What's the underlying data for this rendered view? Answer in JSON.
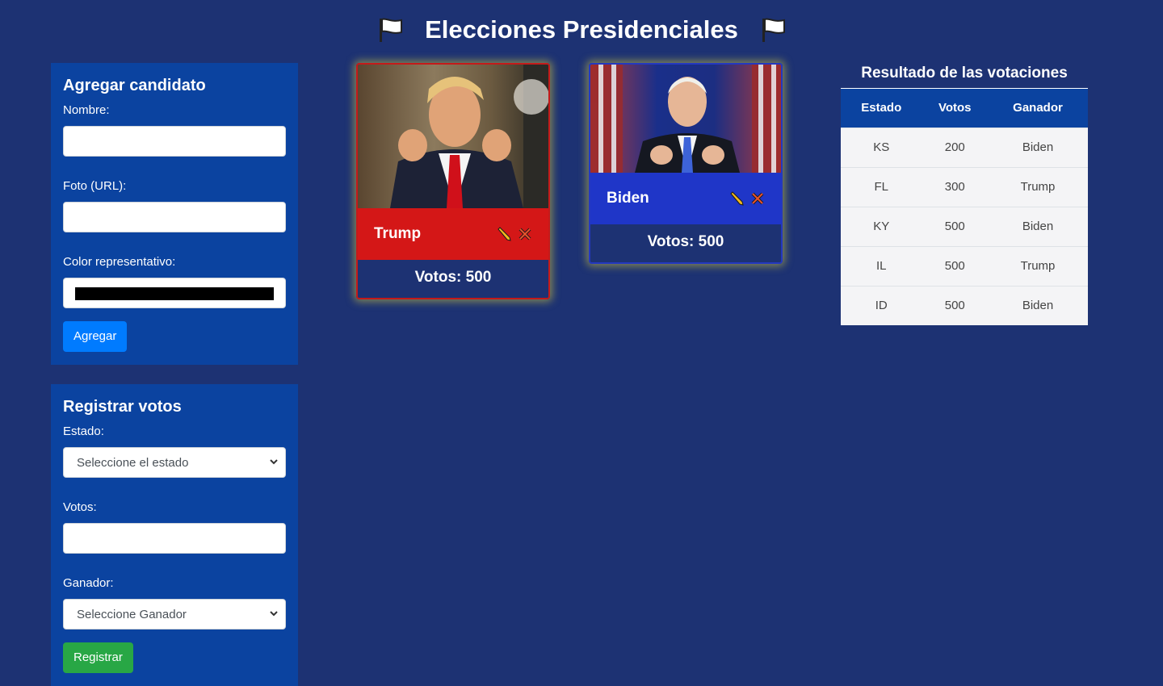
{
  "header": {
    "title": "Elecciones Presidenciales",
    "flag_icon": "white-flag-icon"
  },
  "add_candidate": {
    "title": "Agregar candidato",
    "name_label": "Nombre:",
    "name_value": "",
    "photo_label": "Foto (URL):",
    "photo_value": "",
    "color_label": "Color representativo:",
    "color_value": "#000000",
    "button": "Agregar"
  },
  "register_votes": {
    "title": "Registrar votos",
    "state_label": "Estado:",
    "state_selected": "Seleccione el estado",
    "votes_label": "Votos:",
    "votes_value": "",
    "winner_label": "Ganador:",
    "winner_selected": "Seleccione Ganador",
    "button": "Registrar"
  },
  "candidates": [
    {
      "name": "Trump",
      "votes": "Votos: 500",
      "color": "#d41717"
    },
    {
      "name": "Biden",
      "votes": "Votos: 500",
      "color": "#1f36c8"
    }
  ],
  "results": {
    "title": "Resultado de las votaciones",
    "headers": [
      "Estado",
      "Votos",
      "Ganador"
    ],
    "rows": [
      [
        "KS",
        "200",
        "Biden"
      ],
      [
        "FL",
        "300",
        "Trump"
      ],
      [
        "KY",
        "500",
        "Biden"
      ],
      [
        "IL",
        "500",
        "Trump"
      ],
      [
        "ID",
        "500",
        "Biden"
      ]
    ]
  },
  "colors": {
    "background": "#1d3273",
    "panel": "#0b43a0",
    "primary": "#007bff",
    "success": "#28a745"
  }
}
